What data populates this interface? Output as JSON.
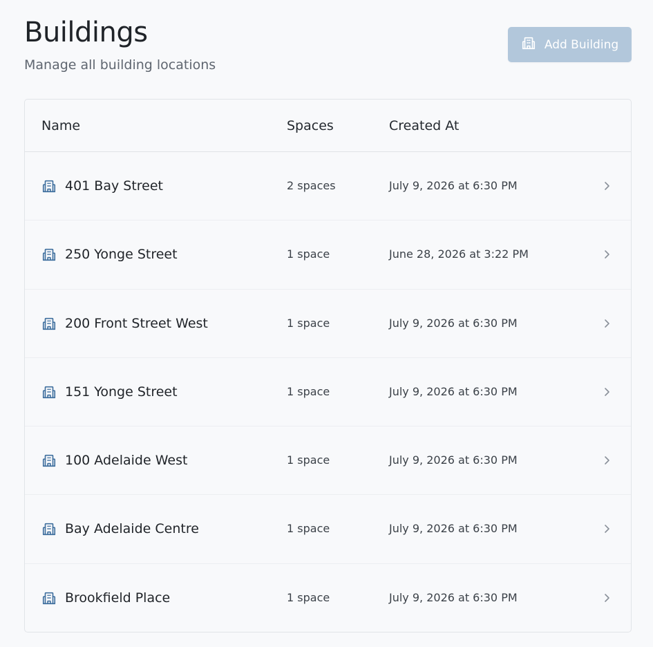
{
  "header": {
    "title": "Buildings",
    "subtitle": "Manage all building locations",
    "add_button_label": "Add Building",
    "add_button_icon": "building-icon"
  },
  "table": {
    "columns": {
      "name": "Name",
      "spaces": "Spaces",
      "created_at": "Created At"
    },
    "rows": [
      {
        "name": "401 Bay Street",
        "spaces": "2 spaces",
        "created_at": "July 9, 2026 at 6:30 PM"
      },
      {
        "name": "250 Yonge Street",
        "spaces": "1 space",
        "created_at": "June 28, 2026 at 3:22 PM"
      },
      {
        "name": "200 Front Street West",
        "spaces": "1 space",
        "created_at": "July 9, 2026 at 6:30 PM"
      },
      {
        "name": "151 Yonge Street",
        "spaces": "1 space",
        "created_at": "July 9, 2026 at 6:30 PM"
      },
      {
        "name": "100 Adelaide West",
        "spaces": "1 space",
        "created_at": "July 9, 2026 at 6:30 PM"
      },
      {
        "name": "Bay Adelaide Centre",
        "spaces": "1 space",
        "created_at": "July 9, 2026 at 6:30 PM"
      },
      {
        "name": "Brookfield Place",
        "spaces": "1 space",
        "created_at": "July 9, 2026 at 6:30 PM"
      }
    ]
  },
  "colors": {
    "background": "#f8f9fb",
    "button_disabled": "#b2c7db",
    "icon_blue": "#3f6f9e",
    "chevron": "#8a9099"
  }
}
